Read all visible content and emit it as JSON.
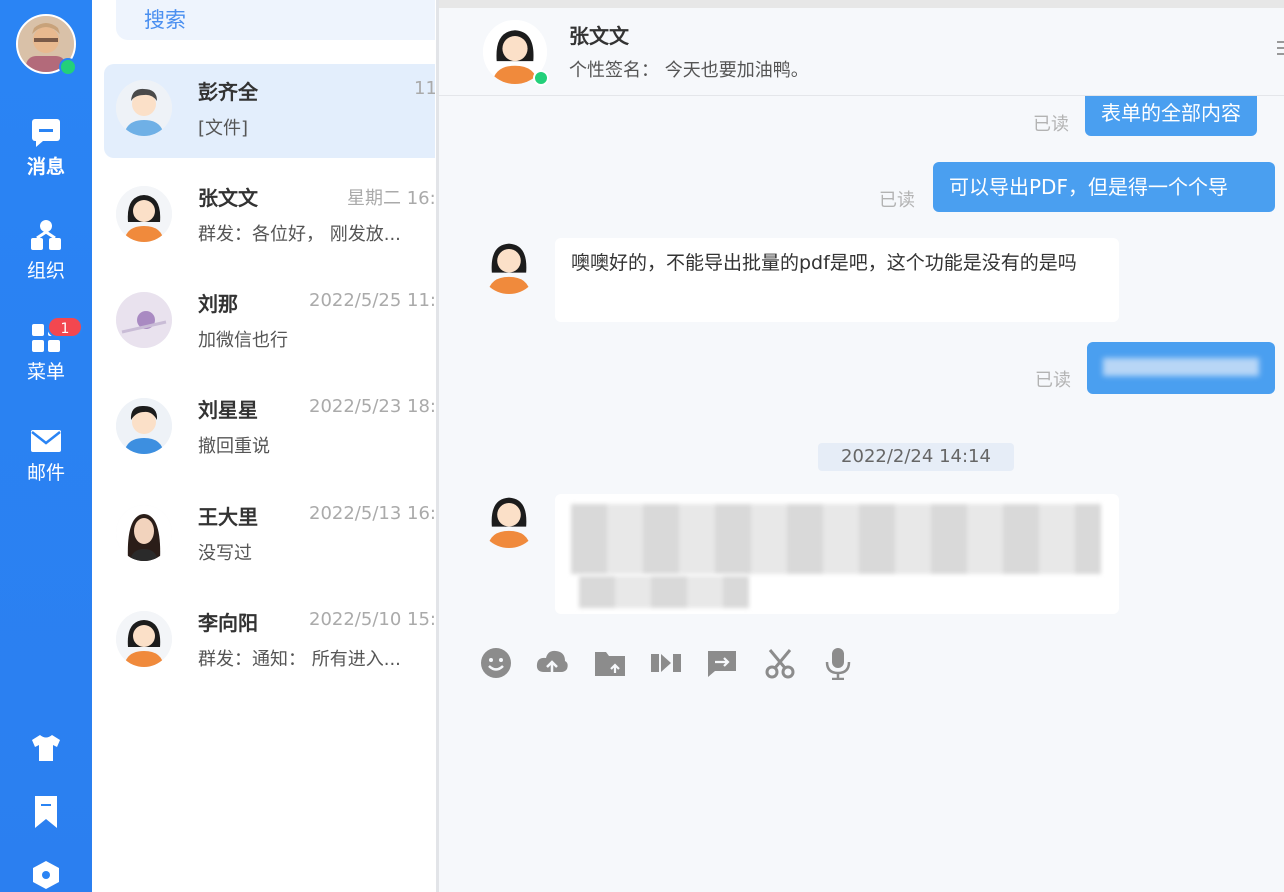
{
  "nav": {
    "items": [
      {
        "label": "消息",
        "icon": "chat-bubble-icon",
        "active": true
      },
      {
        "label": "组织",
        "icon": "organization-icon",
        "active": false
      },
      {
        "label": "菜单",
        "icon": "grid-menu-icon",
        "active": false,
        "badge": "1"
      },
      {
        "label": "邮件",
        "icon": "mail-icon",
        "active": false
      }
    ],
    "bottom_icons": [
      "shirt-icon",
      "bookmark-icon",
      "hexagon-icon"
    ]
  },
  "search": {
    "placeholder": "搜索"
  },
  "conversations": [
    {
      "name": "彭齐全",
      "time": "11:",
      "preview": "[文件]",
      "selected": true
    },
    {
      "name": "张文文",
      "time": "星期二 16:",
      "preview": "群发：各位好， 刚发放..."
    },
    {
      "name": "刘那",
      "time": "2022/5/25 11:",
      "preview": "加微信也行"
    },
    {
      "name": "刘星星",
      "time": "2022/5/23 18:",
      "preview": "撤回重说"
    },
    {
      "name": "王大里",
      "time": "2022/5/13 16:",
      "preview": "没写过"
    },
    {
      "name": "李向阳",
      "time": "2022/5/10 15:",
      "preview": "群发：通知： 所有进入..."
    }
  ],
  "chat": {
    "contact_name": "张文文",
    "signature": "个性签名： 今天也要加油鸭。",
    "messages": [
      {
        "dir": "out",
        "status": "已读",
        "text": "表单的全部内容"
      },
      {
        "dir": "out",
        "status": "已读",
        "text": "可以导出PDF，但是得一个个导"
      },
      {
        "dir": "in",
        "text": "噢噢好的，不能导出批量的pdf是吧，这个功能是没有的是吗"
      },
      {
        "dir": "out",
        "status": "已读",
        "text": ""
      },
      {
        "dir": "in",
        "text": ""
      }
    ],
    "date_divider": "2022/2/24 14:14"
  },
  "composer": {
    "tools": [
      "emoji-icon",
      "upload-cloud-icon",
      "folder-upload-icon",
      "video-icon",
      "forward-icon",
      "scissors-icon",
      "microphone-icon"
    ]
  },
  "colors": {
    "rail": "#2a84f4",
    "bubble_out": "#4a9ff0",
    "online": "#23d07a",
    "badge": "#f3474f"
  }
}
